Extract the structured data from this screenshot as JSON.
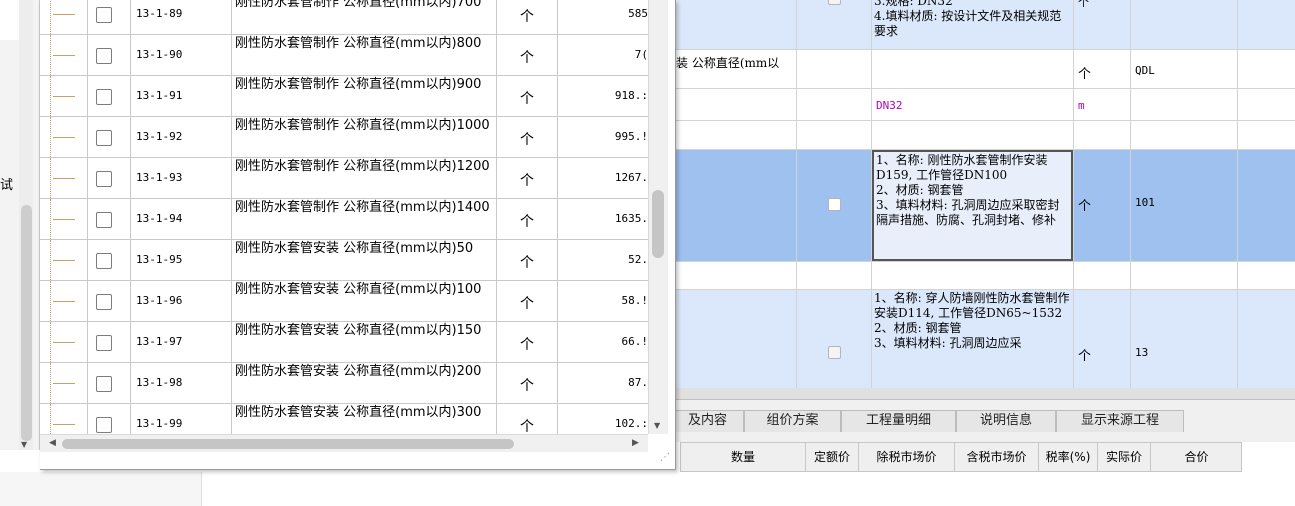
{
  "left_panel": {
    "fragment_text": "试"
  },
  "popup": {
    "rows": [
      {
        "code": "13-1-89",
        "name": "刚性防水套管制作 公称直径(mm以内)700",
        "unit": "个",
        "price": "585"
      },
      {
        "code": "13-1-90",
        "name": "刚性防水套管制作 公称直径(mm以内)800",
        "unit": "个",
        "price": "7("
      },
      {
        "code": "13-1-91",
        "name": "刚性防水套管制作 公称直径(mm以内)900",
        "unit": "个",
        "price": "918.:"
      },
      {
        "code": "13-1-92",
        "name": "刚性防水套管制作 公称直径(mm以内)1000",
        "unit": "个",
        "price": "995.!"
      },
      {
        "code": "13-1-93",
        "name": "刚性防水套管制作 公称直径(mm以内)1200",
        "unit": "个",
        "price": "1267."
      },
      {
        "code": "13-1-94",
        "name": "刚性防水套管制作 公称直径(mm以内)1400",
        "unit": "个",
        "price": "1635."
      },
      {
        "code": "13-1-95",
        "name": "刚性防水套管安装 公称直径(mm以内)50",
        "unit": "个",
        "price": "52."
      },
      {
        "code": "13-1-96",
        "name": "刚性防水套管安装 公称直径(mm以内)100",
        "unit": "个",
        "price": "58.!"
      },
      {
        "code": "13-1-97",
        "name": "刚性防水套管安装 公称直径(mm以内)150",
        "unit": "个",
        "price": "66.!"
      },
      {
        "code": "13-1-98",
        "name": "刚性防水套管安装 公称直径(mm以内)200",
        "unit": "个",
        "price": "87."
      },
      {
        "code": "13-1-99",
        "name": "刚性防水套管安装 公称直径(mm以内)300",
        "unit": "个",
        "price": "102.:"
      }
    ]
  },
  "main_grid": {
    "row1": {
      "feature": "3.规格: DN32\n4.填料材质: 按设计文件及相关规范要求",
      "unit": "个"
    },
    "row2": {
      "name": "装 公称直径(mm以",
      "unit": "个",
      "qty": "QDL"
    },
    "row3": {
      "feature": "DN32",
      "unit": "m"
    },
    "row4": {},
    "row5": {
      "feature": "1、名称: 刚性防水套管制作安装D159, 工作管径DN100\n2、材质: 钢套管\n3、填料材料: 孔洞周边应采取密封隔声措施、防腐、孔洞封堵、修补",
      "unit": "个",
      "qty": "101"
    },
    "row6": {},
    "row7": {
      "feature": "1、名称: 穿人防墙刚性防水套管制作安装D114, 工作管径DN65~1532\n2、材质: 钢套管\n3、填料材料: 孔洞周边应采",
      "unit": "个",
      "qty": "13"
    }
  },
  "tabs": [
    "及内容",
    "组价方案",
    "工程量明细",
    "说明信息",
    "显示来源工程"
  ],
  "bottom_columns": [
    "数量",
    "定额价",
    "除税市场价",
    "含税市场价",
    "税率(%)",
    "实际价",
    "合价"
  ]
}
